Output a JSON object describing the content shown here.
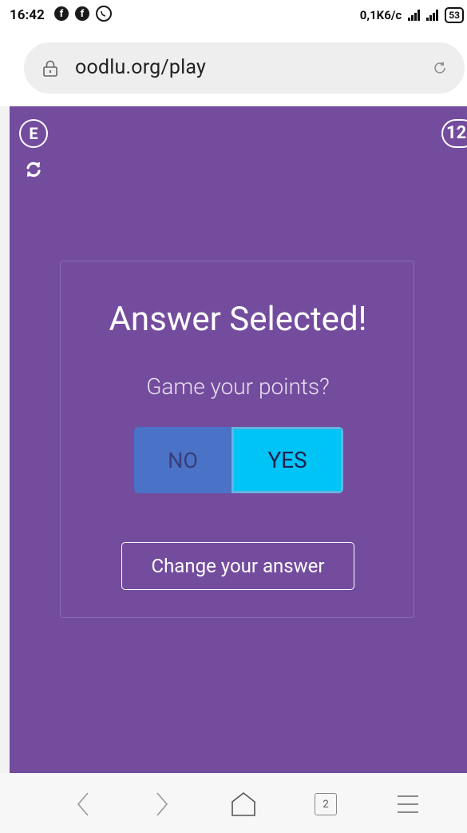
{
  "status": {
    "time": "16:42",
    "network_speed": "0,1K6/c",
    "battery": "53",
    "icons": [
      "facebook-icon",
      "facebook-icon",
      "viber-icon",
      "signal-icon",
      "signal-h-icon",
      "battery-icon"
    ]
  },
  "browser": {
    "url": "oodlu.org/play",
    "tab_count": "2",
    "icons": [
      "lock-icon",
      "reload-icon",
      "back-icon",
      "forward-icon",
      "home-icon",
      "tabs-icon",
      "menu-icon"
    ]
  },
  "game": {
    "badge_letter": "E",
    "badge_number": "12",
    "card": {
      "title": "Answer Selected!",
      "question": "Game your points?",
      "option_no": "NO",
      "option_yes": "YES",
      "selected": "YES",
      "change_button": "Change your answer"
    }
  },
  "colors": {
    "game_bg": "#744c9e",
    "yes_active": "#00c4f5",
    "no_inactive": "#4a72c6"
  }
}
